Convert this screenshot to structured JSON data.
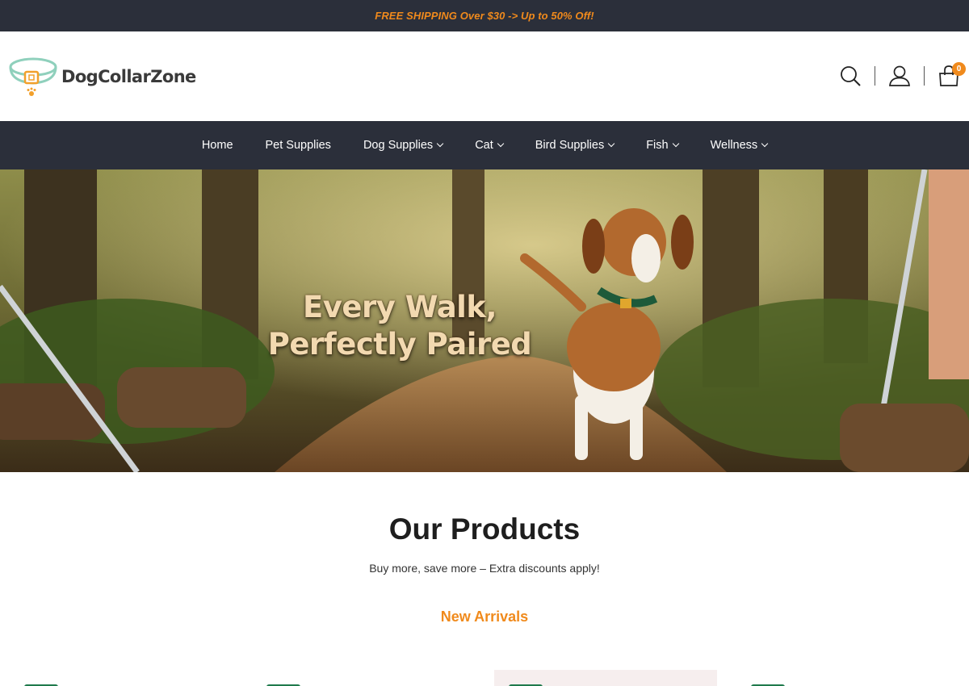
{
  "announcement": "FREE SHIPPING Over $30 -> Up to 50% Off!",
  "brand": {
    "name": "DogCollarZone",
    "logo_icon": "dog-collar-paw-icon"
  },
  "header_icons": {
    "search": "search-icon",
    "account": "user-icon",
    "cart": "shopping-bag-icon",
    "cart_count": "0"
  },
  "nav": {
    "items": [
      {
        "label": "Home",
        "has_dropdown": false
      },
      {
        "label": "Pet Supplies",
        "has_dropdown": false
      },
      {
        "label": "Dog Supplies",
        "has_dropdown": true
      },
      {
        "label": "Cat",
        "has_dropdown": true
      },
      {
        "label": "Bird Supplies",
        "has_dropdown": true
      },
      {
        "label": "Fish",
        "has_dropdown": true
      },
      {
        "label": "Wellness",
        "has_dropdown": true
      }
    ]
  },
  "hero": {
    "headline_line1": "Every Walk,",
    "headline_line2": "Perfectly Paired"
  },
  "products": {
    "title": "Our Products",
    "subtitle": "Buy more, save more – Extra discounts apply!",
    "active_tab": "New Arrivals"
  },
  "colors": {
    "dark": "#2b2f3a",
    "accent": "#f08a1c",
    "tag_green": "#1f7a4c"
  }
}
